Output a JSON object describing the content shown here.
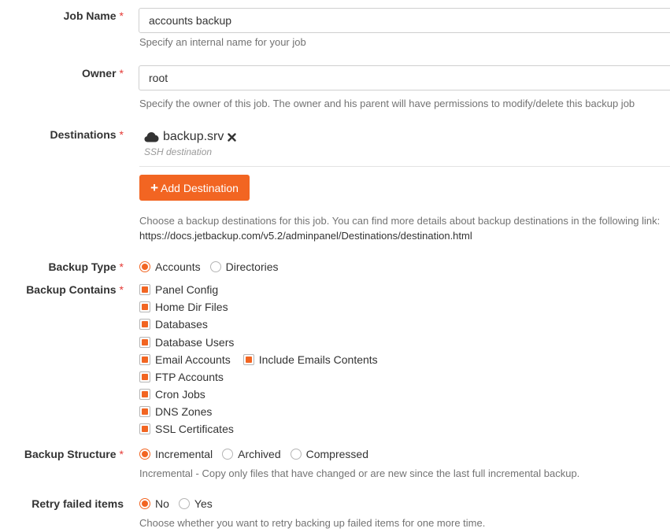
{
  "form": {
    "required_mark": "*",
    "job_name": {
      "label": "Job Name",
      "value": "accounts backup",
      "help": "Specify an internal name for your job"
    },
    "owner": {
      "label": "Owner",
      "value": "root",
      "help": "Specify the owner of this job. The owner and his parent will have permissions to modify/delete this backup job"
    },
    "destinations": {
      "label": "Destinations",
      "items": [
        {
          "name": "backup.srv",
          "type": "SSH destination",
          "icon": "cloud-icon",
          "remove_icon": "close-icon"
        }
      ],
      "add_button": "Add Destination",
      "help_line1": "Choose a backup destinations for this job. You can find more details about backup destinations in the following link:",
      "help_link": "https://docs.jetbackup.com/v5.2/adminpanel/Destinations/destination.html"
    },
    "backup_type": {
      "label": "Backup Type",
      "options": [
        {
          "label": "Accounts",
          "selected": true
        },
        {
          "label": "Directories",
          "selected": false
        }
      ]
    },
    "backup_contains": {
      "label": "Backup Contains",
      "items": [
        {
          "label": "Panel Config",
          "checked": true
        },
        {
          "label": "Home Dir Files",
          "checked": true
        },
        {
          "label": "Databases",
          "checked": true
        },
        {
          "label": "Database Users",
          "checked": true
        },
        {
          "label": "Email Accounts",
          "checked": true
        },
        {
          "label": "FTP Accounts",
          "checked": true
        },
        {
          "label": "Cron Jobs",
          "checked": true
        },
        {
          "label": "DNS Zones",
          "checked": true
        },
        {
          "label": "SSL Certificates",
          "checked": true
        }
      ],
      "include_emails": {
        "label": "Include Emails Contents",
        "checked": true
      }
    },
    "backup_structure": {
      "label": "Backup Structure",
      "options": [
        {
          "label": "Incremental",
          "selected": true
        },
        {
          "label": "Archived",
          "selected": false
        },
        {
          "label": "Compressed",
          "selected": false
        }
      ],
      "help": "Incremental - Copy only files that have changed or are new since the last full incremental backup."
    },
    "retry_failed": {
      "label": "Retry failed items",
      "options": [
        {
          "label": "No",
          "selected": true
        },
        {
          "label": "Yes",
          "selected": false
        }
      ],
      "help": "Choose whether you want to retry backing up failed items for one more time."
    }
  },
  "colors": {
    "accent": "#f26522",
    "required": "#e53935",
    "help_text": "#737373"
  }
}
